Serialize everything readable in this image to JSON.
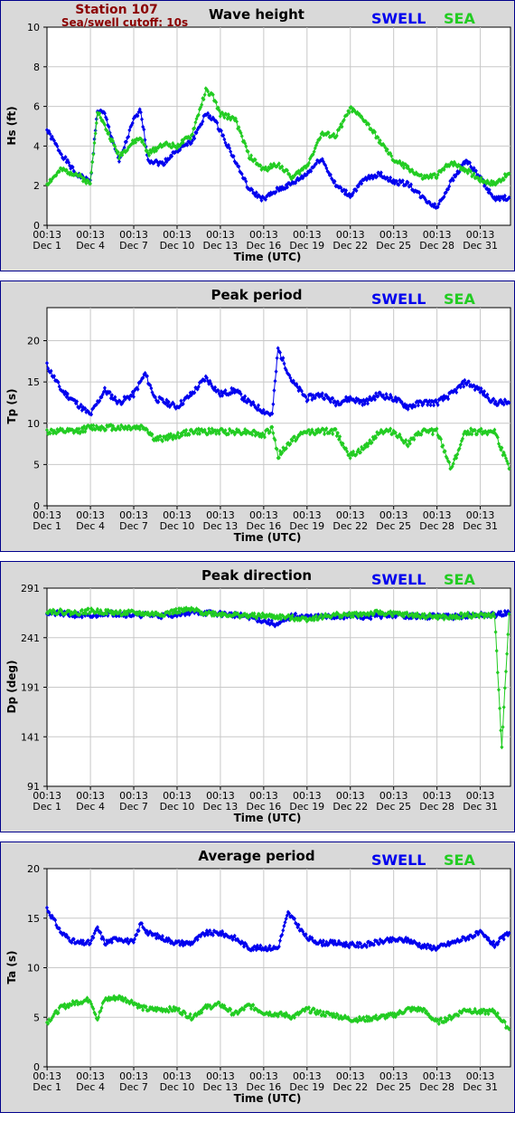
{
  "station": {
    "name": "Station 107",
    "cutoff": "Sea/swell cutoff: 10s"
  },
  "legend": {
    "swell": "SWELL",
    "sea": "SEA"
  },
  "colors": {
    "swell": "#0000ee",
    "sea": "#22cc22",
    "station": "#8b0000",
    "frame": "#00008b",
    "panel_bg": "#d9d9d9"
  },
  "x_axis": {
    "label": "Time (UTC)",
    "tick_times": [
      "00:13",
      "00:13",
      "00:13",
      "00:13",
      "00:13",
      "00:13",
      "00:13",
      "00:13",
      "00:13",
      "00:13",
      "00:13"
    ],
    "tick_dates": [
      "Dec 1",
      "Dec 4",
      "Dec 7",
      "Dec 10",
      "Dec 13",
      "Dec 16",
      "Dec 19",
      "Dec 22",
      "Dec 25",
      "Dec 28",
      "Dec 31"
    ]
  },
  "chart_data": [
    {
      "type": "line",
      "title": "Wave height",
      "ylabel": "Hs (ft)",
      "ylim": [
        0,
        10
      ],
      "yticks": [
        0,
        2,
        4,
        6,
        8,
        10
      ],
      "xlim_days": [
        1,
        33.1
      ],
      "grid": true,
      "legend": "top-right",
      "x": [
        1,
        2,
        3,
        4,
        4.5,
        5,
        6,
        7,
        7.5,
        8,
        9,
        10,
        11,
        12,
        12.5,
        13,
        14,
        15,
        16,
        17,
        18,
        19,
        20,
        21,
        22,
        23,
        24,
        25,
        26,
        27,
        28,
        29,
        30,
        31,
        32,
        33
      ],
      "series": [
        {
          "name": "SWELL",
          "values": [
            4.8,
            3.6,
            2.6,
            2.2,
            5.8,
            5.6,
            3.2,
            5.3,
            5.8,
            3.3,
            3.1,
            3.8,
            4.2,
            5.6,
            5.4,
            4.8,
            3.3,
            1.8,
            1.3,
            1.8,
            2.1,
            2.6,
            3.4,
            2.0,
            1.5,
            2.3,
            2.6,
            2.2,
            2.1,
            1.4,
            0.9,
            2.2,
            3.3,
            2.4,
            1.3,
            1.4
          ]
        },
        {
          "name": "SEA",
          "values": [
            2.1,
            2.8,
            2.6,
            2.1,
            5.8,
            5.0,
            3.5,
            4.2,
            4.4,
            3.6,
            4.1,
            4.0,
            4.5,
            6.8,
            6.5,
            5.6,
            5.4,
            3.5,
            2.8,
            3.1,
            2.4,
            3.0,
            4.6,
            4.5,
            5.9,
            5.3,
            4.3,
            3.3,
            2.9,
            2.4,
            2.5,
            3.2,
            2.8,
            2.3,
            2.1,
            2.6
          ]
        }
      ]
    },
    {
      "type": "line",
      "title": "Peak period",
      "ylabel": "Tp (s)",
      "ylim": [
        0,
        24
      ],
      "yticks": [
        0,
        5,
        10,
        15,
        20
      ],
      "xlim_days": [
        1,
        33.1
      ],
      "grid": true,
      "legend": "top-right",
      "x": [
        1,
        2,
        3,
        4,
        5,
        6,
        7,
        7.8,
        8.5,
        10,
        11,
        12,
        13,
        14,
        15,
        16,
        16.6,
        17,
        18,
        19,
        20,
        21,
        22,
        23,
        24,
        25,
        26,
        27,
        28,
        29,
        30,
        31,
        32,
        33
      ],
      "series": [
        {
          "name": "SWELL",
          "values": [
            17,
            14,
            12.5,
            11,
            14,
            12.5,
            13.5,
            16,
            13,
            12,
            13.5,
            15.5,
            13.5,
            14,
            12.5,
            11.5,
            11,
            19,
            15,
            13,
            13.5,
            12.5,
            13,
            12.5,
            13.5,
            13,
            12,
            12.5,
            12.5,
            13.5,
            15,
            14,
            12.5,
            12.5
          ]
        },
        {
          "name": "SEA",
          "values": [
            9,
            9,
            9,
            9.5,
            9.5,
            9.5,
            9.5,
            9.5,
            8,
            8.5,
            9,
            9,
            9,
            9,
            9,
            8.5,
            9.5,
            6,
            8,
            9,
            9,
            9,
            6,
            7,
            9,
            9,
            7.5,
            9,
            9,
            4.5,
            9,
            9,
            9,
            4.5
          ]
        }
      ]
    },
    {
      "type": "line",
      "title": "Peak direction",
      "ylabel": "Dp (deg)",
      "ylim": [
        91,
        291
      ],
      "yticks": [
        91,
        141,
        191,
        241,
        291
      ],
      "xlim_days": [
        1,
        33.1
      ],
      "grid": true,
      "legend": "top-right",
      "x": [
        1,
        2,
        3,
        4,
        5,
        6,
        7,
        8,
        9,
        10,
        11,
        12,
        13,
        14,
        15,
        16,
        17,
        18,
        19,
        20,
        21,
        22,
        23,
        24,
        25,
        26,
        27,
        28,
        29,
        30,
        31,
        32,
        32.5,
        33
      ],
      "series": [
        {
          "name": "SWELL",
          "values": [
            266,
            265,
            264,
            262,
            266,
            265,
            264,
            264,
            263,
            265,
            267,
            266,
            265,
            264,
            262,
            258,
            254,
            263,
            262,
            262,
            262,
            263,
            262,
            263,
            264,
            263,
            262,
            263,
            262,
            263,
            264,
            264,
            265,
            266
          ]
        },
        {
          "name": "SEA",
          "values": [
            268,
            267,
            266,
            268,
            267,
            266,
            266,
            265,
            265,
            268,
            269,
            266,
            265,
            264,
            263,
            263,
            262,
            261,
            260,
            262,
            264,
            264,
            265,
            266,
            265,
            264,
            263,
            262,
            261,
            264,
            263,
            264,
            130,
            265
          ]
        }
      ]
    },
    {
      "type": "line",
      "title": "Average period",
      "ylabel": "Ta (s)",
      "ylim": [
        0,
        20
      ],
      "yticks": [
        0,
        5,
        10,
        15,
        20
      ],
      "xlim_days": [
        1,
        33.1
      ],
      "grid": true,
      "legend": "top-right",
      "x": [
        1,
        2,
        3,
        4,
        4.5,
        5,
        6,
        7,
        7.5,
        8,
        9,
        10,
        11,
        12,
        13,
        14,
        15,
        16,
        17,
        17.7,
        18,
        19,
        20,
        21,
        22,
        23,
        24,
        25,
        26,
        27,
        28,
        29,
        30,
        31,
        32,
        33
      ],
      "series": [
        {
          "name": "SWELL",
          "values": [
            16,
            13.5,
            12.5,
            12.5,
            14,
            12.5,
            13,
            12.5,
            14.5,
            13.5,
            13,
            12.5,
            12.5,
            13.5,
            13.5,
            13,
            12,
            12,
            12,
            15.5,
            15,
            13,
            12.5,
            12.5,
            12.3,
            12.3,
            12.6,
            12.8,
            12.8,
            12.2,
            12,
            12.5,
            13,
            13.5,
            12.3,
            13.5
          ]
        },
        {
          "name": "SEA",
          "values": [
            4.5,
            6,
            6.5,
            6.8,
            4.8,
            6.8,
            7,
            6.5,
            6,
            5.8,
            5.8,
            5.8,
            5,
            6,
            6.3,
            5.3,
            6.2,
            5.5,
            5.3,
            5.2,
            5,
            5.8,
            5.4,
            5.2,
            4.8,
            4.8,
            5,
            5.2,
            5.8,
            5.8,
            4.5,
            5,
            5.8,
            5.5,
            5.6,
            3.8
          ]
        }
      ]
    }
  ]
}
